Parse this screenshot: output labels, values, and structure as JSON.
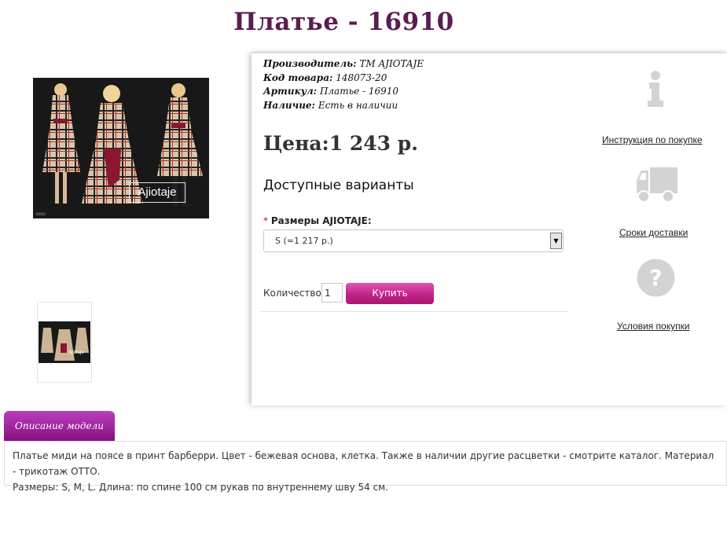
{
  "product": {
    "title": "Платье - 16910",
    "image_brand": "Ajiotaje",
    "image_code": "16910",
    "thumb_brand": "Ajiotaje"
  },
  "meta": [
    {
      "label": "Производитель:",
      "value": "ТМ AJIOTAJE"
    },
    {
      "label": "Код товара:",
      "value": "148073-20"
    },
    {
      "label": "Артикул:",
      "value": "Платье - 16910"
    },
    {
      "label": "Наличие:",
      "value": "Есть в наличии"
    }
  ],
  "price_text": "Цена:1 243 р.",
  "variants": {
    "heading": "Доступные варианты",
    "required_mark": "*",
    "size_label": "Размеры AJIOTAJE:",
    "selected_size": "S (=1 217 р.)"
  },
  "purchase": {
    "qty_label": "Количество:",
    "qty_value": "1",
    "buy_label": "Купить"
  },
  "side": {
    "info_link": "Инструкция по покупке",
    "delivery_link": "Сроки доставки",
    "conditions_link": "Условия покупки"
  },
  "tabs": {
    "description_tab": "Описание модели"
  },
  "description": {
    "line1": "Платье миди на поясе в принт барберри. Цвет - бежевая основа, клетка. Также в наличии другие расцветки - смотрите каталог. Материал - трикотаж ОТТО.",
    "line2": "Размеры: S, M, L. Длина: по спине 100 см рукав по внутреннему шву 54 см."
  },
  "colors": {
    "title": "#5a1d4f",
    "buy_button": "#c0238a",
    "tab": "#9b1f93",
    "icon_gray": "#d3d3d3"
  }
}
